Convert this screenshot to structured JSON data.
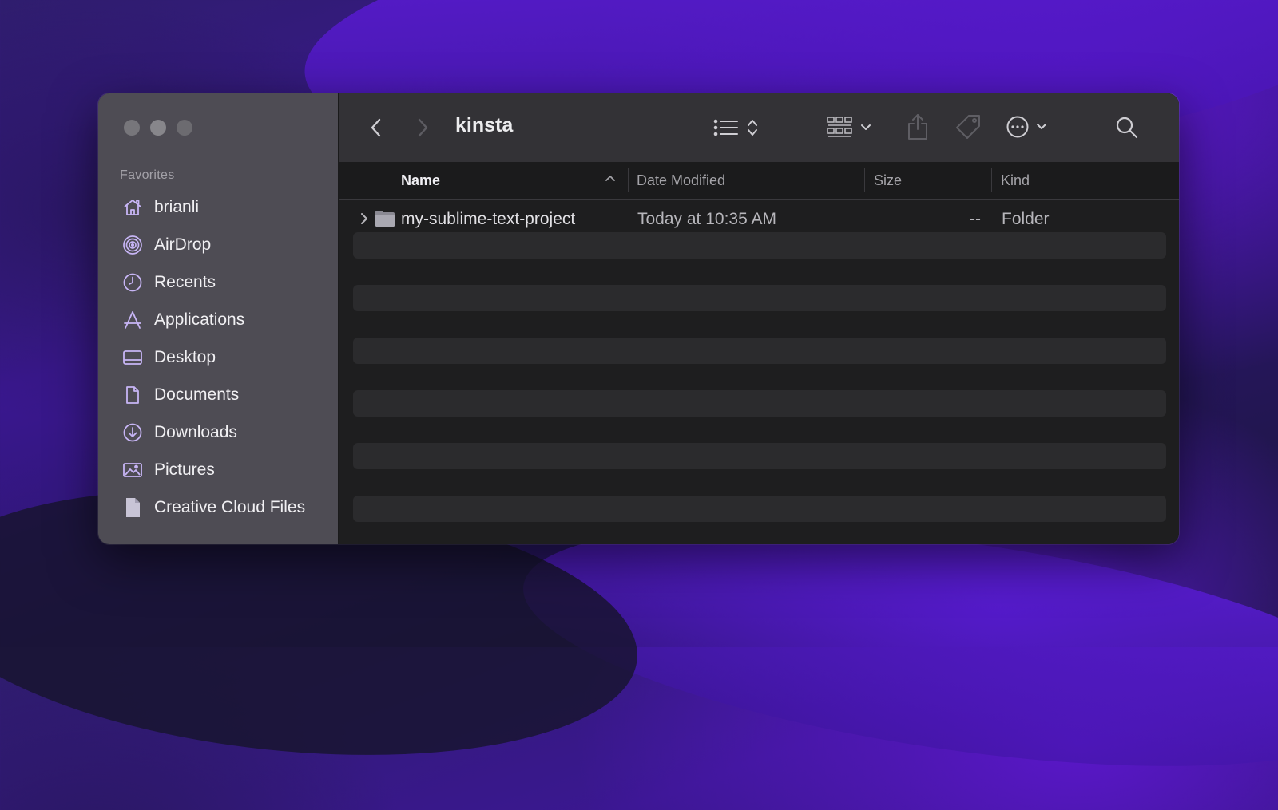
{
  "window": {
    "title": "kinsta"
  },
  "sidebar": {
    "section_label": "Favorites",
    "items": [
      {
        "label": "brianli",
        "icon": "home-icon"
      },
      {
        "label": "AirDrop",
        "icon": "airdrop-icon"
      },
      {
        "label": "Recents",
        "icon": "clock-icon"
      },
      {
        "label": "Applications",
        "icon": "applications-icon"
      },
      {
        "label": "Desktop",
        "icon": "desktop-icon"
      },
      {
        "label": "Documents",
        "icon": "document-icon"
      },
      {
        "label": "Downloads",
        "icon": "download-icon"
      },
      {
        "label": "Pictures",
        "icon": "pictures-icon"
      },
      {
        "label": "Creative Cloud Files",
        "icon": "file-icon"
      }
    ]
  },
  "toolbar": {
    "icons": [
      "back-icon",
      "forward-icon",
      "list-view-icon",
      "sort-chevrons-icon",
      "group-grid-icon",
      "chevron-down-icon",
      "share-icon",
      "tag-icon",
      "more-icon",
      "chevron-down-icon",
      "search-icon"
    ]
  },
  "columns": {
    "name": "Name",
    "date_modified": "Date Modified",
    "size": "Size",
    "kind": "Kind"
  },
  "files": [
    {
      "name": "my-sublime-text-project",
      "date_modified": "Today at 10:35 AM",
      "size": "--",
      "kind": "Folder",
      "icon": "folder-icon"
    }
  ],
  "colors": {
    "sidebar_bg": "#4e4c54",
    "toolbar_bg": "#333236",
    "content_bg": "#1e1e1f",
    "accent_icon": "#c7b5f5"
  }
}
